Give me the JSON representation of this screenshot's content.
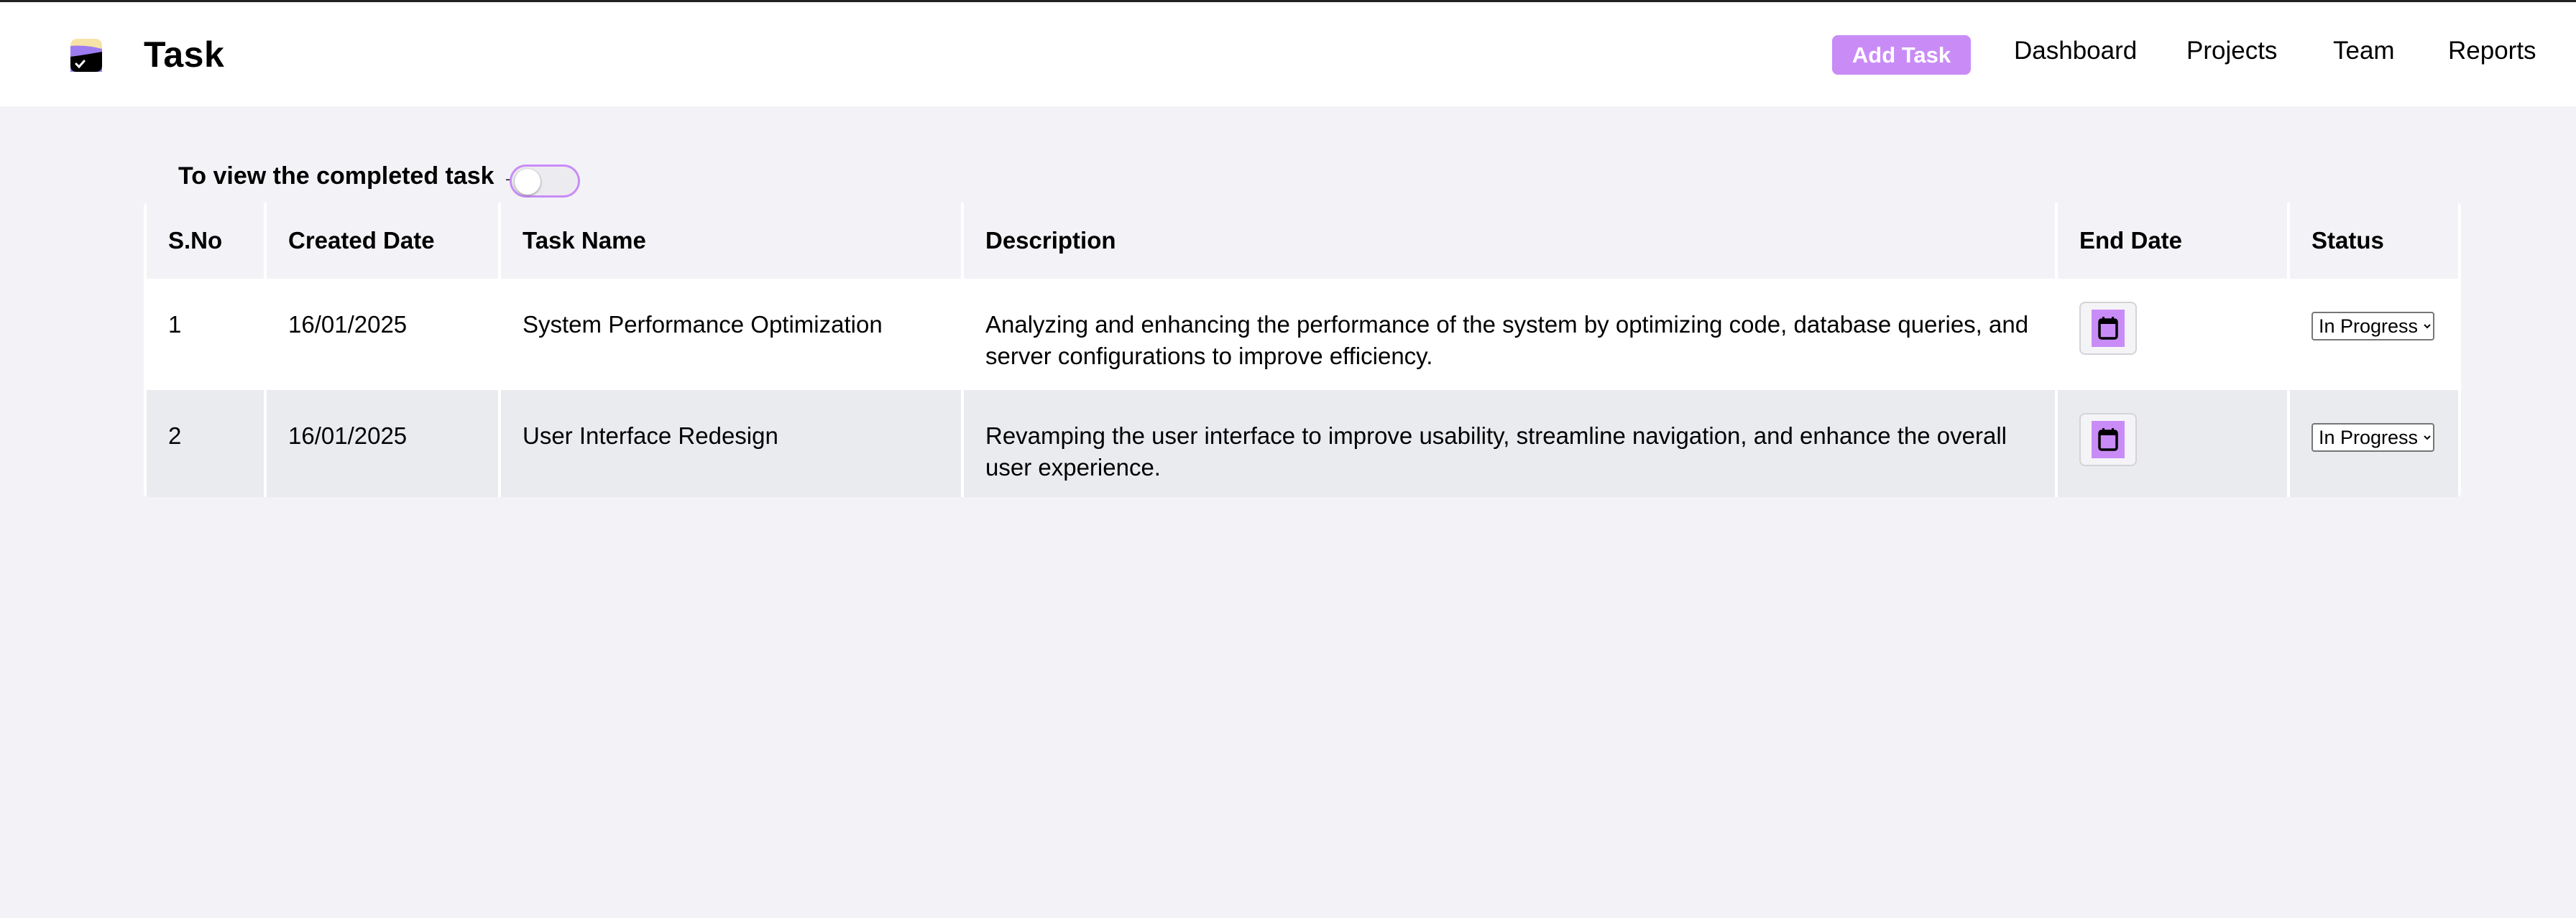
{
  "app": {
    "title": "Task",
    "logo_icon": "task-logo-icon"
  },
  "header": {
    "add_task_label": "Add Task",
    "nav": [
      {
        "label": "Dashboard"
      },
      {
        "label": "Projects"
      },
      {
        "label": "Team"
      },
      {
        "label": "Reports"
      }
    ]
  },
  "completed_toggle": {
    "label": "To view the completed task →",
    "on": false
  },
  "table": {
    "columns": [
      "S.No",
      "Created Date",
      "Task Name",
      "Description",
      "End Date",
      "Status"
    ],
    "rows": [
      {
        "sno": "1",
        "created": "16/01/2025",
        "name": "System Performance Optimization",
        "description": "Analyzing and enhancing the performance of the system by optimizing code, database queries, and server configurations to improve efficiency.",
        "end_date_icon": "calendar-icon",
        "status": "In Progress"
      },
      {
        "sno": "2",
        "created": "16/01/2025",
        "name": "User Interface Redesign",
        "description": "Revamping the user interface to improve usability, streamline navigation, and enhance the overall user experience.",
        "end_date_icon": "calendar-icon",
        "status": "In Progress"
      }
    ]
  },
  "colors": {
    "accent": "#c98cf7",
    "background": "#f3f3f7",
    "row_alt": "#eaebef"
  }
}
